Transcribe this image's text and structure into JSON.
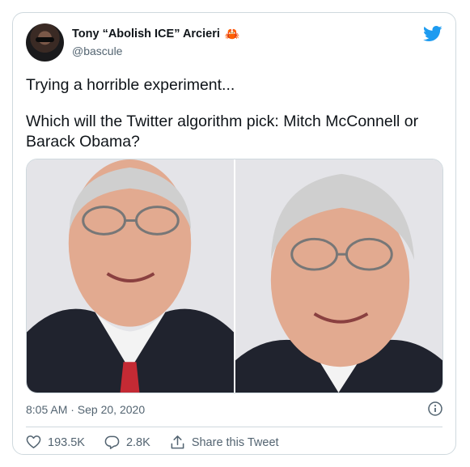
{
  "tweet": {
    "author_name": "Tony “Abolish ICE” Arcieri",
    "author_emoji": "🦀",
    "handle": "@bascule",
    "text_line1": "Trying a horrible experiment...",
    "text_line2": "Which will the Twitter algorithm pick: Mitch McConnell or",
    "text_line3": "Barack Obama?",
    "timestamp": "8:05 AM · Sep 20, 2020"
  },
  "actions": {
    "likes": "193.5K",
    "replies": "2.8K",
    "share_label": "Share this Tweet"
  },
  "icons": {
    "brand": "twitter-bird-icon",
    "info": "info-icon",
    "like": "heart-icon",
    "reply": "reply-icon",
    "share": "share-icon"
  },
  "colors": {
    "brand": "#1d9bf0",
    "text": "#0f1419",
    "muted": "#536471",
    "border": "#cfd9de"
  }
}
